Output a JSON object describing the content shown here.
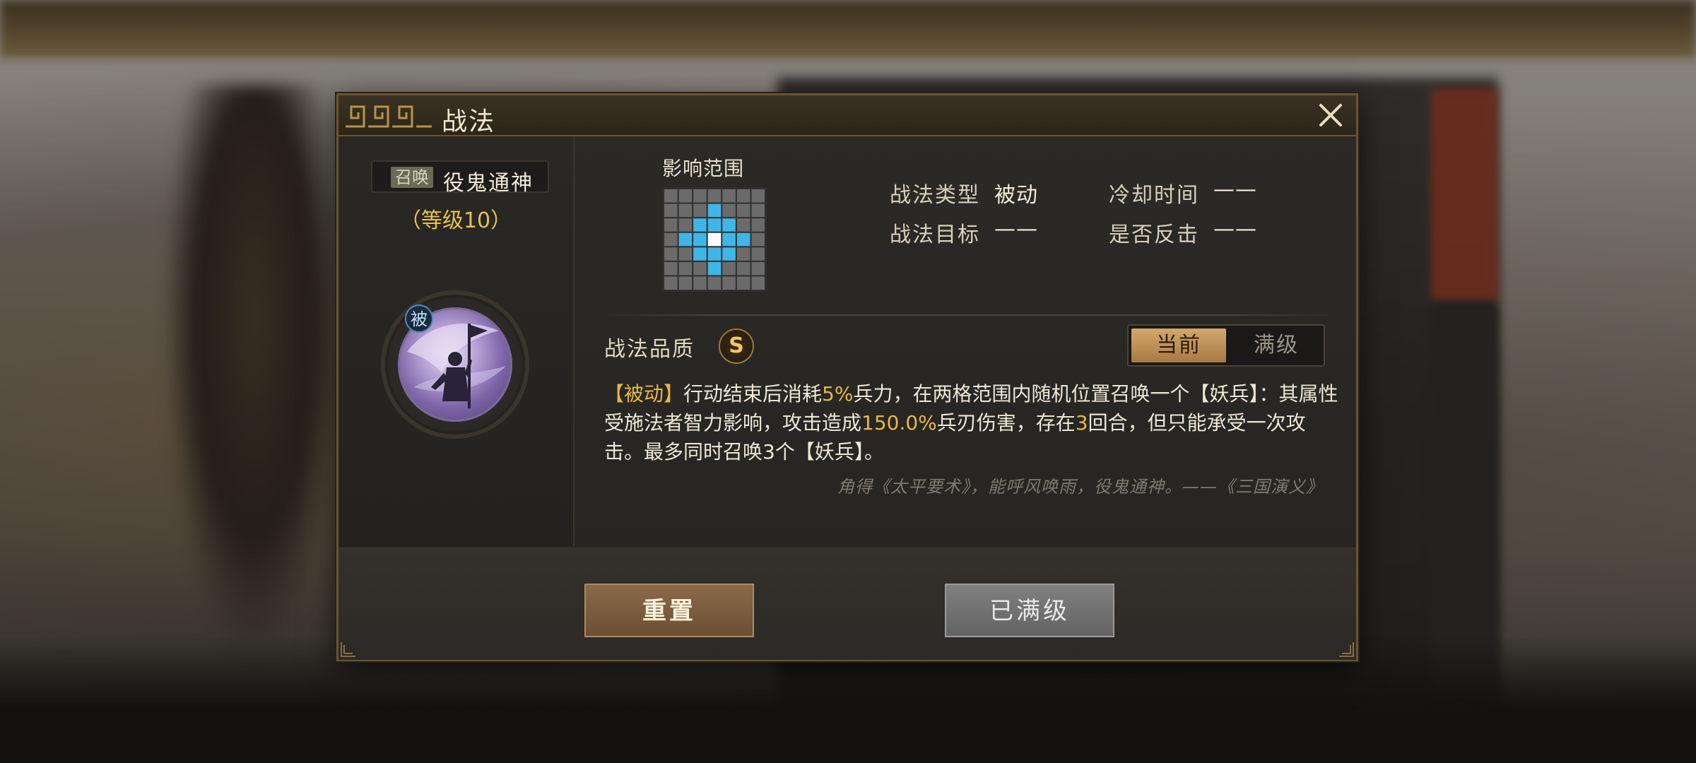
{
  "dialog": {
    "title": "战法",
    "close_icon": "close-icon"
  },
  "skill": {
    "summon_tag": "召唤",
    "name": "役鬼通神",
    "level": "（等级10）",
    "passive_badge": "被"
  },
  "range": {
    "label": "影响范围",
    "grid_size": 7,
    "affected_cells": [
      [
        1,
        3
      ],
      [
        2,
        2
      ],
      [
        2,
        3
      ],
      [
        2,
        4
      ],
      [
        3,
        1
      ],
      [
        3,
        2
      ],
      [
        3,
        4
      ],
      [
        3,
        5
      ],
      [
        4,
        2
      ],
      [
        4,
        3
      ],
      [
        4,
        4
      ],
      [
        5,
        3
      ]
    ],
    "center_cell": [
      3,
      3
    ],
    "colors": {
      "cell": "#6b6b6b",
      "affected": "#3fb6e6",
      "center": "#ffffff",
      "grid_line": "#2f2f2f"
    }
  },
  "info": {
    "type_label": "战法类型",
    "type_value": "被动",
    "cooldown_label": "冷却时间",
    "cooldown_value": "——",
    "target_label": "战法目标",
    "target_value": "——",
    "counter_label": "是否反击",
    "counter_value": "——"
  },
  "quality": {
    "label": "战法品质",
    "grade": "S"
  },
  "toggle": {
    "current": "当前",
    "max": "满级"
  },
  "description": {
    "p1": "【被动】",
    "p2": "行动结束后消耗",
    "p3": "5%",
    "p4": "兵力，在两格范围内随机位置召唤一个【妖兵】：其属性受施法者智力影响，攻击造成",
    "p5": "150.0%",
    "p6": "兵刃伤害，存在",
    "p7": "3",
    "p8": "回合，但只能承受一次攻击。最多同时召唤3个【妖兵】。"
  },
  "quote": "角得《太平要术》，能呼风唤雨，役鬼通神。——《三国演义》",
  "buttons": {
    "reset": "重置",
    "maxed": "已满级"
  },
  "colors": {
    "accent_gold": "#e7b840",
    "frame": "#6b5432",
    "reset_button": "#7a5c3f",
    "maxed_button": "#707070"
  }
}
